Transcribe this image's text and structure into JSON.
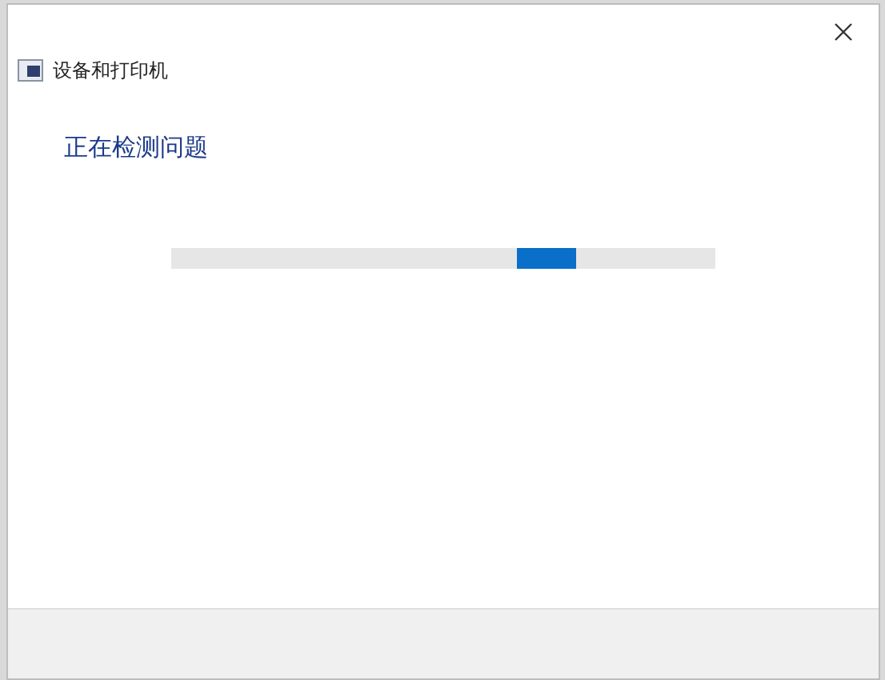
{
  "window": {
    "title": "设备和打印机"
  },
  "heading": "正在检测问题",
  "progress": {
    "indeterminate": true
  }
}
